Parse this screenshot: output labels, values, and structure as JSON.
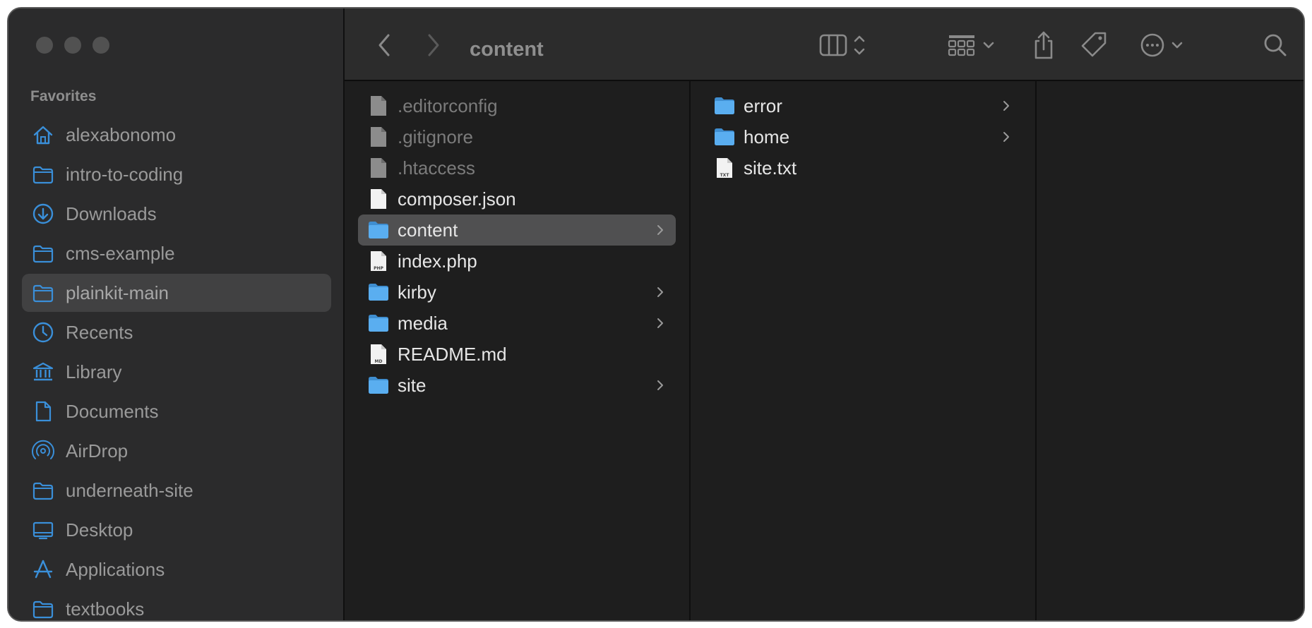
{
  "window": {
    "title": "content"
  },
  "sidebar": {
    "heading": "Favorites",
    "items": [
      {
        "label": "alexabonomo",
        "icon": "home-icon"
      },
      {
        "label": "intro-to-coding",
        "icon": "folder-icon"
      },
      {
        "label": "Downloads",
        "icon": "download-icon"
      },
      {
        "label": "cms-example",
        "icon": "folder-icon"
      },
      {
        "label": "plainkit-main",
        "icon": "folder-icon",
        "selected": true
      },
      {
        "label": "Recents",
        "icon": "clock-icon"
      },
      {
        "label": "Library",
        "icon": "library-icon"
      },
      {
        "label": "Documents",
        "icon": "document-icon"
      },
      {
        "label": "AirDrop",
        "icon": "airdrop-icon"
      },
      {
        "label": "underneath-site",
        "icon": "folder-icon"
      },
      {
        "label": "Desktop",
        "icon": "desktop-icon"
      },
      {
        "label": "Applications",
        "icon": "applications-icon"
      },
      {
        "label": "textbooks",
        "icon": "folder-icon"
      }
    ]
  },
  "toolbar": {
    "back": "back-icon",
    "forward": "forward-icon",
    "view": "column-view-icon",
    "group": "group-icon",
    "share": "share-icon",
    "tag": "tag-icon",
    "more": "more-icon",
    "search": "search-icon"
  },
  "columns": [
    {
      "items": [
        {
          "label": ".editorconfig",
          "type": "file-hidden"
        },
        {
          "label": ".gitignore",
          "type": "file-hidden"
        },
        {
          "label": ".htaccess",
          "type": "file-hidden"
        },
        {
          "label": "composer.json",
          "type": "file"
        },
        {
          "label": "content",
          "type": "folder",
          "selected": true
        },
        {
          "label": "index.php",
          "type": "file",
          "badge": "PHP"
        },
        {
          "label": "kirby",
          "type": "folder"
        },
        {
          "label": "media",
          "type": "folder"
        },
        {
          "label": "README.md",
          "type": "file",
          "badge": "MD"
        },
        {
          "label": "site",
          "type": "folder"
        }
      ]
    },
    {
      "items": [
        {
          "label": "error",
          "type": "folder"
        },
        {
          "label": "home",
          "type": "folder"
        },
        {
          "label": "site.txt",
          "type": "file",
          "badge": "TXT"
        }
      ]
    },
    {
      "items": []
    }
  ],
  "colors": {
    "folder": "#5aaef0",
    "sidebar_icon": "#3a8fd9",
    "selection": "#505051"
  }
}
